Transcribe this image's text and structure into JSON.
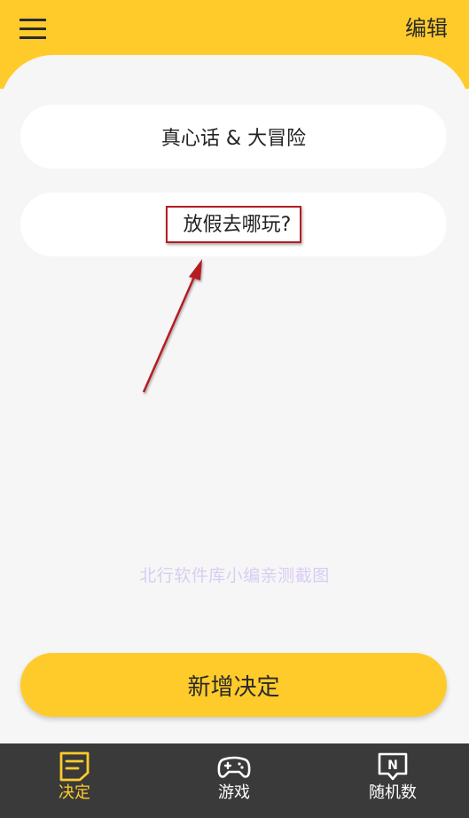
{
  "header": {
    "edit_label": "编辑"
  },
  "list": {
    "items": [
      {
        "label": "真心话 & 大冒险"
      },
      {
        "label": "放假去哪玩?"
      }
    ]
  },
  "watermark": "北行软件库小编亲测截图",
  "add_button_label": "新增决定",
  "tabs": [
    {
      "label": "决定",
      "icon": "decision-icon",
      "active": true
    },
    {
      "label": "游戏",
      "icon": "gamepad-icon",
      "active": false
    },
    {
      "label": "随机数",
      "icon": "random-number-icon",
      "active": false
    }
  ],
  "colors": {
    "accent": "#ffcb2b",
    "background": "#f6f6f6",
    "tabbar": "#3a3a3a",
    "annotation": "#b51c22"
  }
}
